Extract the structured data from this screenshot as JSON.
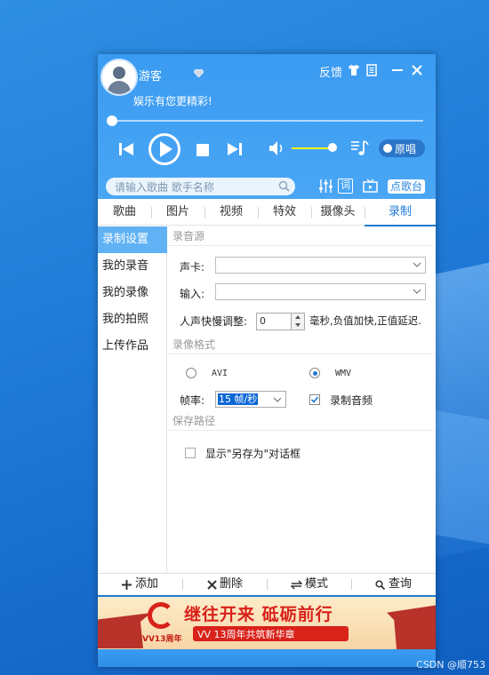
{
  "player": {
    "username": "游客",
    "slogan": "娱乐有您更精彩!",
    "feedback": "反馈",
    "original_toggle": "原唱",
    "search_placeholder": "请输入歌曲 歌手名称",
    "lyrics_btn": "词",
    "request_btn": "点歌台",
    "accent_color": "#3a9bf2"
  },
  "tabs": [
    "歌曲",
    "图片",
    "视频",
    "特效",
    "摄像头",
    "录制"
  ],
  "active_tab": "录制",
  "side_menu": [
    "录制设置",
    "我的录音",
    "我的录像",
    "我的拍照",
    "上传作品"
  ],
  "audio_source": {
    "section": "录音源",
    "soundcard_label": "声卡:",
    "input_label": "输入:",
    "speed_label": "人声快慢调整:",
    "speed_value": "0",
    "speed_hint": "毫秒,负值加快,正值延迟."
  },
  "video_format": {
    "section": "录像格式",
    "opt_avi": "AVI",
    "opt_wmv": "WMV",
    "selected": "WMV",
    "fps_label": "帧率:",
    "fps_value": "15 帧/秒",
    "record_audio_label": "录制音频",
    "record_audio_checked": true
  },
  "save_path": {
    "section": "保存路径",
    "show_dialog_label": "显示\"另存为\"对话框",
    "show_dialog_checked": false
  },
  "bottom_bar": {
    "add": "添加",
    "delete": "删除",
    "mode": "模式",
    "query": "查询"
  },
  "banner": {
    "title": "继往开来 砥砺前行",
    "subtitle": "VV 13周年共筑新华章",
    "logo": "VV13周年"
  },
  "watermark": "CSDN @顺753"
}
